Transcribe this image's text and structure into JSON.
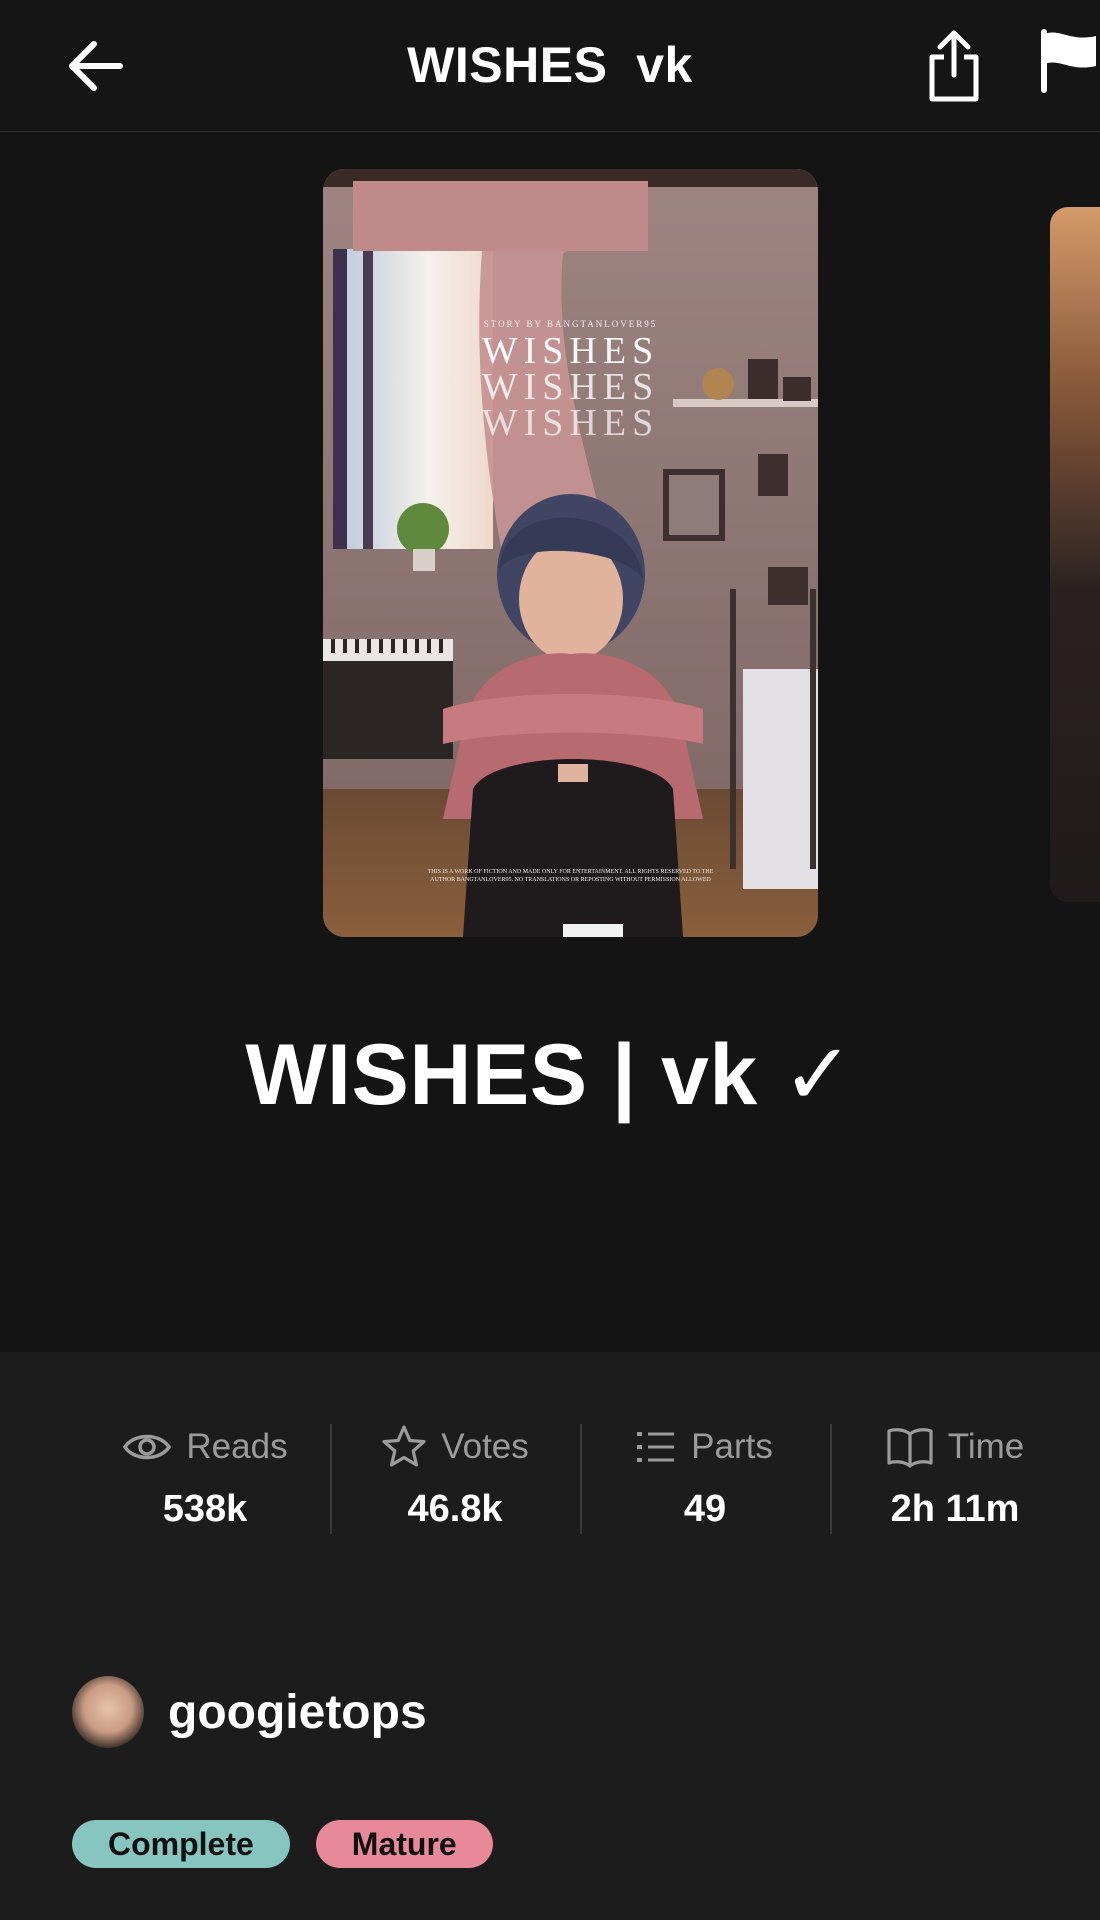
{
  "header": {
    "title": "WISHES  vk",
    "back_icon": "arrow-left-icon",
    "share_icon": "share-icon",
    "report_icon": "flag-icon"
  },
  "cover": {
    "byline": "STORY BY BANGTANLOVER95",
    "title_lines": [
      "WISHES",
      "WISHES",
      "WISHES"
    ],
    "disclaimer_line1": "THIS IS A WORK OF FICTION AND MADE ONLY FOR ENTERTAINMENT. ALL RIGHTS RESERVED TO THE",
    "disclaimer_line2": "AUTHOR BANGTANLOVER95. NO TRANSLATIONS OR REPOSTING WITHOUT PERMISSION ALLOWED"
  },
  "story": {
    "title": "WISHES | vk ✓"
  },
  "stats": [
    {
      "icon": "eye-icon",
      "label": "Reads",
      "value": "538k"
    },
    {
      "icon": "star-icon",
      "label": "Votes",
      "value": "46.8k"
    },
    {
      "icon": "list-icon",
      "label": "Parts",
      "value": "49"
    },
    {
      "icon": "book-icon",
      "label": "Time",
      "value": "2h 11m"
    }
  ],
  "author": {
    "name": "googietops"
  },
  "tags": [
    {
      "label": "Complete",
      "color": "#86c5c0"
    },
    {
      "label": "Mature",
      "color": "#e8899a"
    }
  ]
}
